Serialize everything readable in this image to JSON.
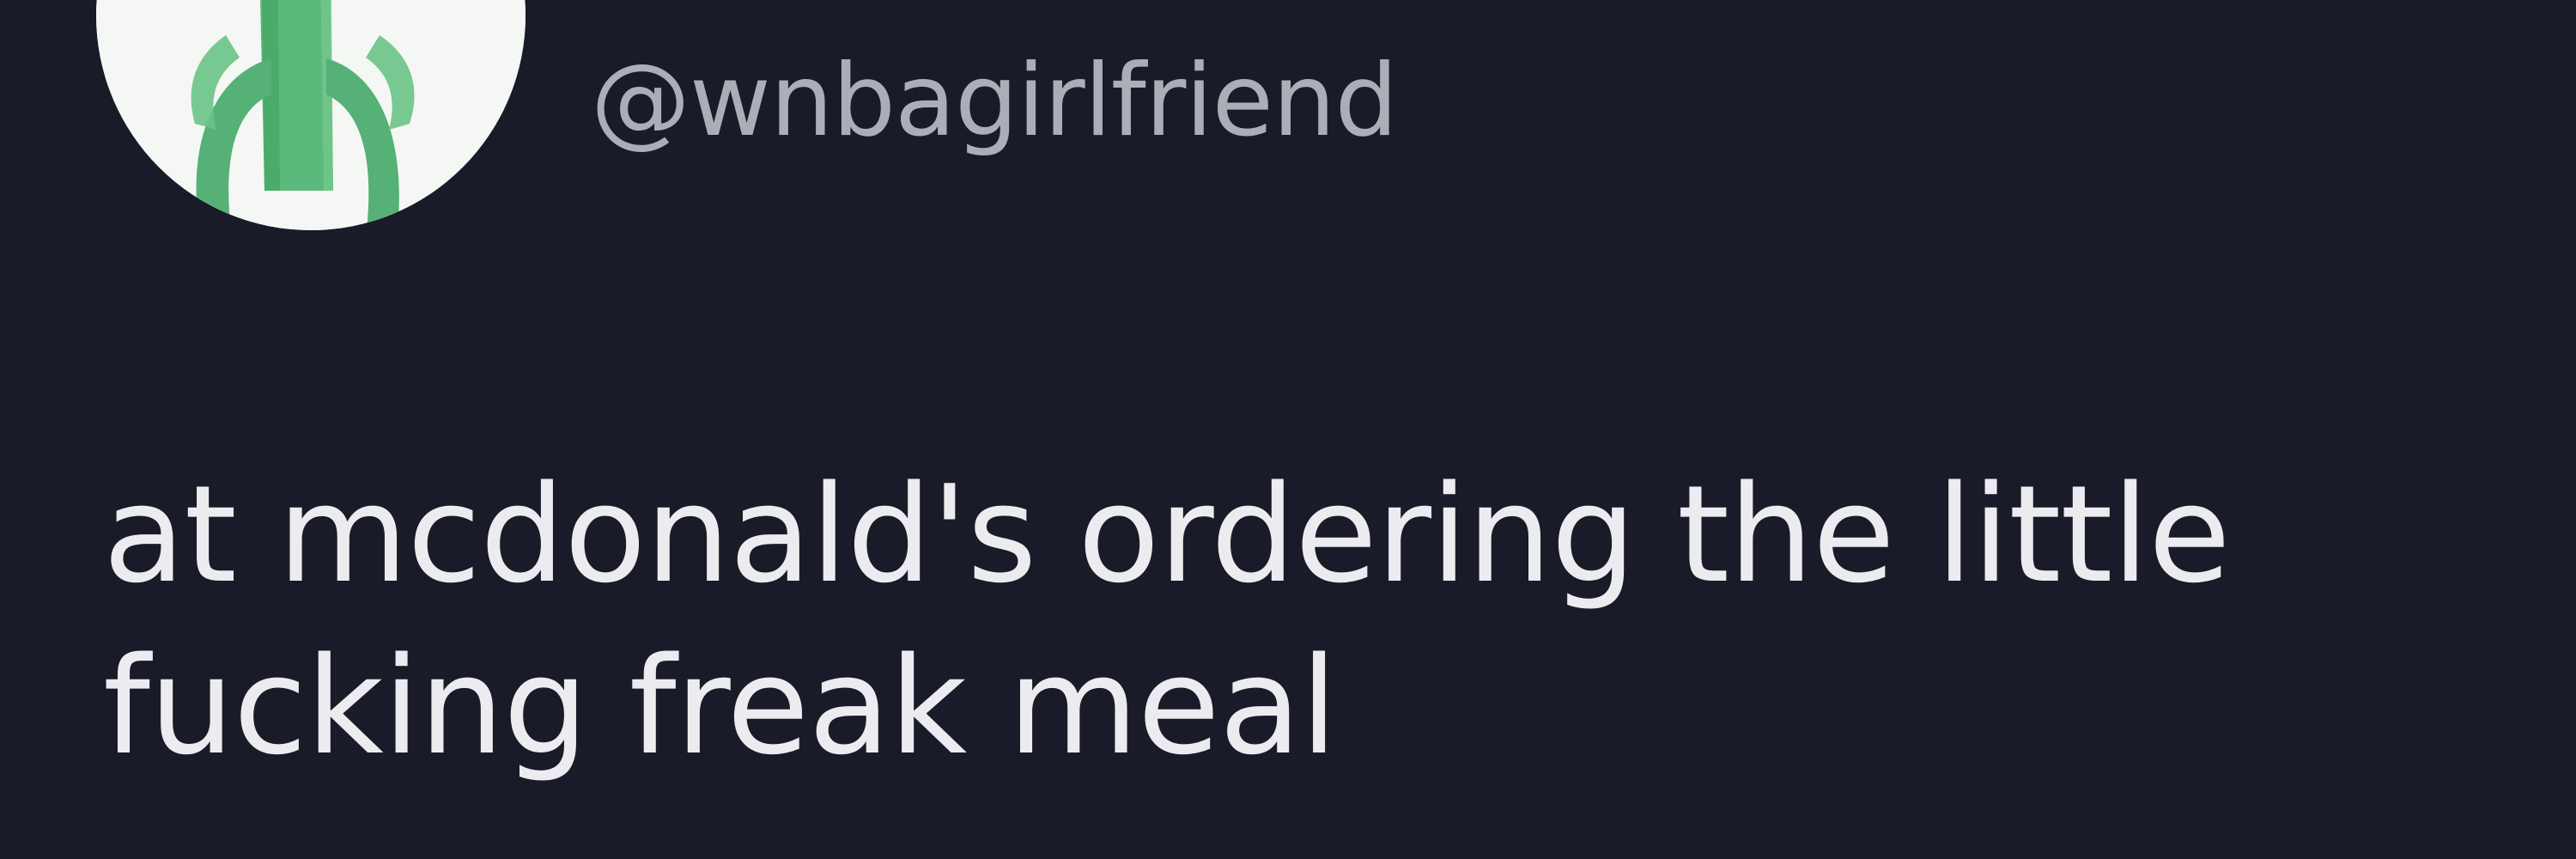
{
  "tweet": {
    "author": {
      "display_name_fragment": "",
      "handle": "@wnbagirlfriend",
      "avatar_icon": "green-figure-avatar-icon"
    },
    "text_lines": [
      "at mcdonald's ordering the little",
      "fucking freak meal"
    ]
  },
  "colors": {
    "background": "#191b28",
    "text": "#ececf0",
    "secondary_text": "#aaaeb6",
    "avatar_background": "#f5f7f4",
    "avatar_figure": "#58b678"
  }
}
